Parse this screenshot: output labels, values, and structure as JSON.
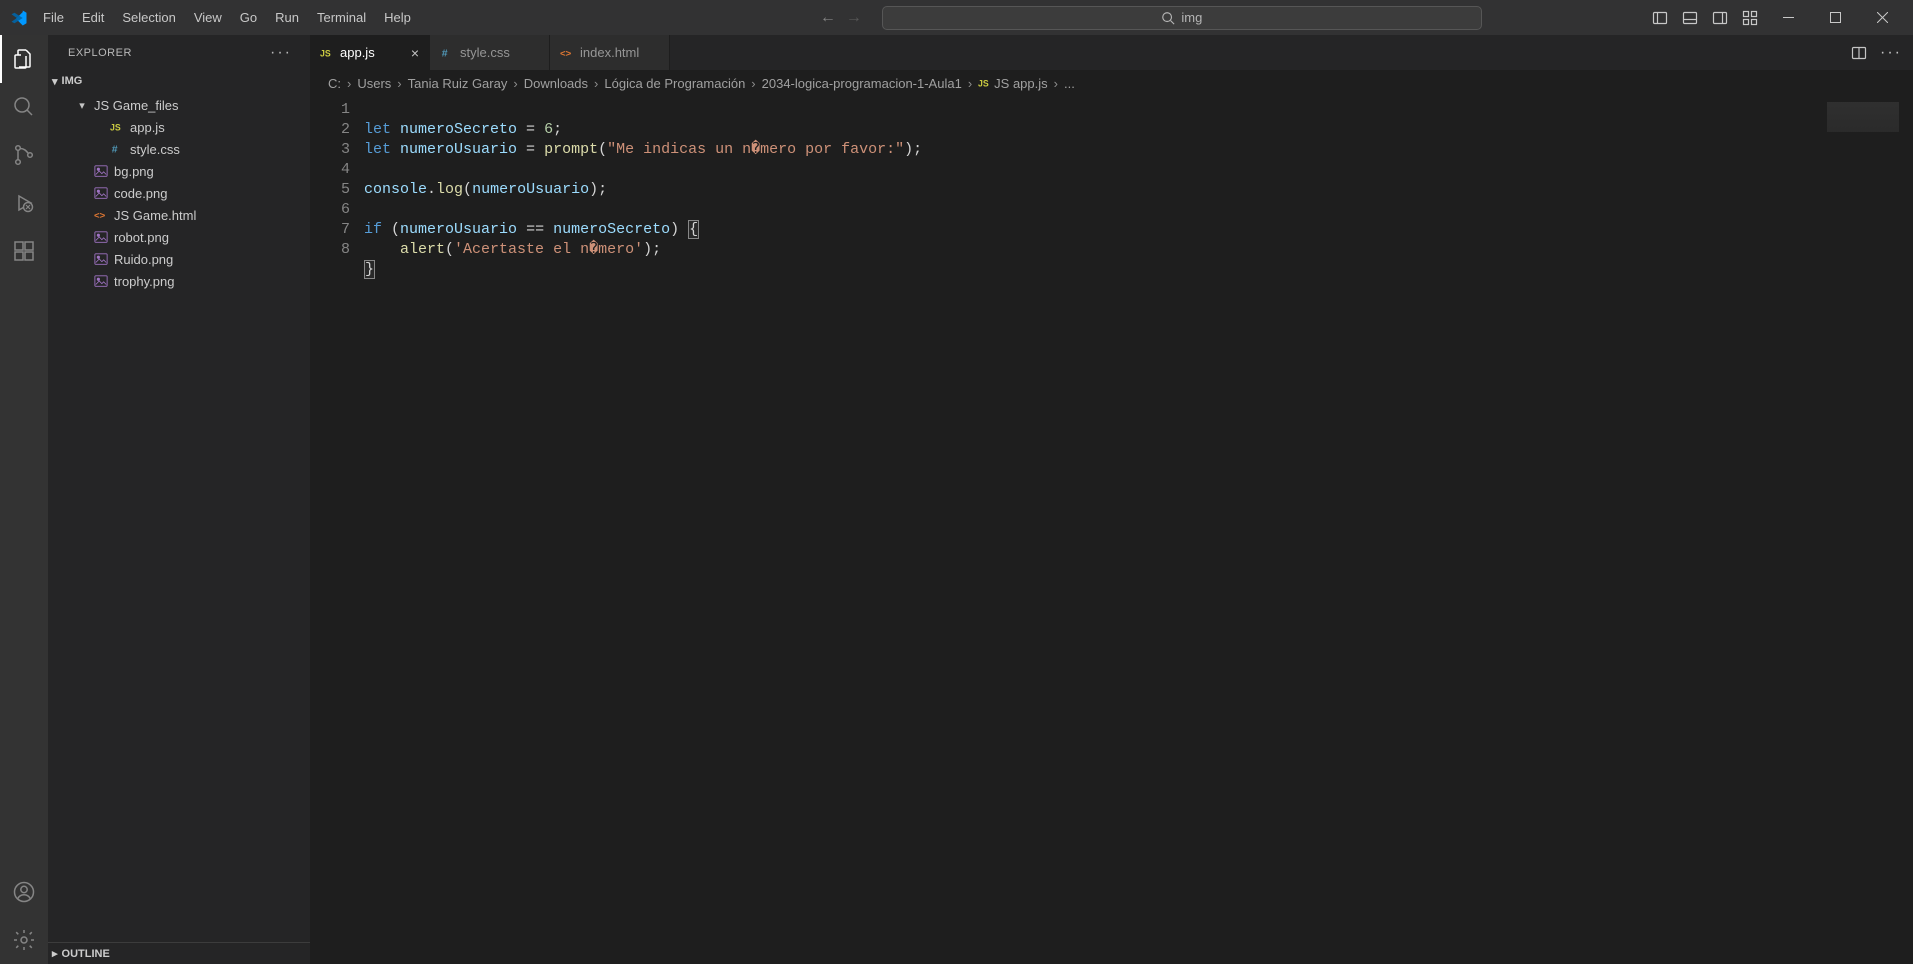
{
  "menu": {
    "items": [
      "File",
      "Edit",
      "Selection",
      "View",
      "Go",
      "Run",
      "Terminal",
      "Help"
    ]
  },
  "search": {
    "text": "img"
  },
  "sidebar": {
    "title": "Explorer",
    "root": "IMG",
    "outline": "Outline",
    "items": [
      {
        "type": "folder",
        "label": "JS Game_files",
        "open": true,
        "indent": 1
      },
      {
        "type": "js",
        "label": "app.js",
        "indent": 2
      },
      {
        "type": "css",
        "label": "style.css",
        "indent": 2
      },
      {
        "type": "img",
        "label": "bg.png",
        "indent": 1
      },
      {
        "type": "img",
        "label": "code.png",
        "indent": 1
      },
      {
        "type": "html",
        "label": "JS Game.html",
        "indent": 1
      },
      {
        "type": "img",
        "label": "robot.png",
        "indent": 1
      },
      {
        "type": "img",
        "label": "Ruido.png",
        "indent": 1
      },
      {
        "type": "img",
        "label": "trophy.png",
        "indent": 1
      }
    ]
  },
  "tabs": [
    {
      "type": "js",
      "label": "app.js",
      "active": true
    },
    {
      "type": "css",
      "label": "style.css",
      "active": false
    },
    {
      "type": "html",
      "label": "index.html",
      "active": false
    }
  ],
  "breadcrumbs": [
    "C:",
    "Users",
    "Tania Ruiz Garay",
    "Downloads",
    "Lógica de Programación",
    "2034-logica-programacion-1-Aula1",
    "JS app.js",
    "..."
  ],
  "code": {
    "lines": [
      1,
      2,
      3,
      4,
      5,
      6,
      7,
      8
    ],
    "l1a": "let ",
    "l1b": "numeroSecreto",
    "l1c": " = ",
    "l1d": "6",
    "l1e": ";",
    "l2a": "let ",
    "l2b": "numeroUsuario",
    "l2c": " = ",
    "l2d": "prompt",
    "l2e": "(",
    "l2f": "\"Me indicas un n�mero por favor:\"",
    "l2g": ");",
    "l4a": "console",
    "l4b": ".",
    "l4c": "log",
    "l4d": "(",
    "l4e": "numeroUsuario",
    "l4f": ");",
    "l6a": "if ",
    "l6b": "(",
    "l6c": "numeroUsuario",
    "l6d": " == ",
    "l6e": "numeroSecreto",
    "l6f": ")",
    " l6g": "{",
    "l7a": "    ",
    "l7b": "alert",
    "l7c": "(",
    "l7d": "'Acertaste el n�mero'",
    "l7e": ");",
    "l8a": "}"
  }
}
